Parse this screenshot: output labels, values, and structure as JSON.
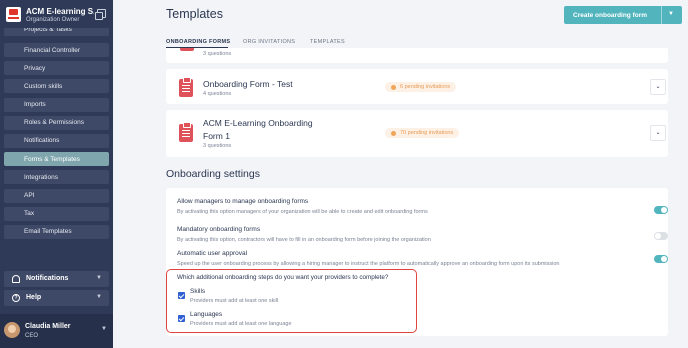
{
  "org": {
    "name": "ACM E-learning S...",
    "role": "Organization Owner"
  },
  "nav": [
    {
      "label": "Projects & Tasks"
    },
    {
      "label": "Financial Controller"
    },
    {
      "label": "Privacy"
    },
    {
      "label": "Custom skills"
    },
    {
      "label": "Imports"
    },
    {
      "label": "Roles & Permissions"
    },
    {
      "label": "Notifications"
    },
    {
      "label": "Forms & Templates",
      "active": true
    },
    {
      "label": "Integrations"
    },
    {
      "label": "API"
    },
    {
      "label": "Tax"
    },
    {
      "label": "Email Templates"
    }
  ],
  "bottom": {
    "notifications": "Notifications",
    "help": "Help"
  },
  "user": {
    "name": "Claudia Miller",
    "role": "CEO"
  },
  "page": {
    "title": "Templates",
    "create_button": "Create onboarding form"
  },
  "tabs": [
    {
      "label": "ONBOARDING FORMS",
      "active": true
    },
    {
      "label": "ORG INVITATIONS"
    },
    {
      "label": "TEMPLATES"
    }
  ],
  "forms": {
    "top_partial_sub": "3 questions",
    "items": [
      {
        "title": "Onboarding Form - Test",
        "sub": "4 questions",
        "pending": "6 pending invitations"
      },
      {
        "title_line1": "ACM E-Learning Onboarding",
        "title_line2": "Form 1",
        "sub": "3 questions",
        "pending": "70 pending invitations"
      }
    ]
  },
  "settings": {
    "title": "Onboarding settings",
    "items": [
      {
        "title": "Allow managers to manage onboarding forms",
        "desc": "By activating this option managers of your organization will be able to create and edit onboarding forms",
        "enabled": true
      },
      {
        "title": "Mandatory onboarding forms",
        "desc": "By activating this option, contractors will have to fill in an onboarding form before joining the organization",
        "enabled": false
      },
      {
        "title": "Automatic user approval",
        "desc": "Speed up the user onboarding process by allowing a hiring manager to instruct the platform to automatically approve an onboarding form upon its submission",
        "enabled": true
      }
    ],
    "question": "Which additional onboarding steps do you want your providers to complete?",
    "steps": [
      {
        "label": "Skills",
        "desc": "Providers must add at least one skill",
        "checked": true
      },
      {
        "label": "Languages",
        "desc": "Providers must add at least one language",
        "checked": true
      }
    ]
  },
  "colors": {
    "sidebar": "#2e3a57",
    "accent": "#52b5bd",
    "active_nav": "#7fa6ad",
    "highlight": "#e0443e",
    "pending": "#e89a54"
  }
}
